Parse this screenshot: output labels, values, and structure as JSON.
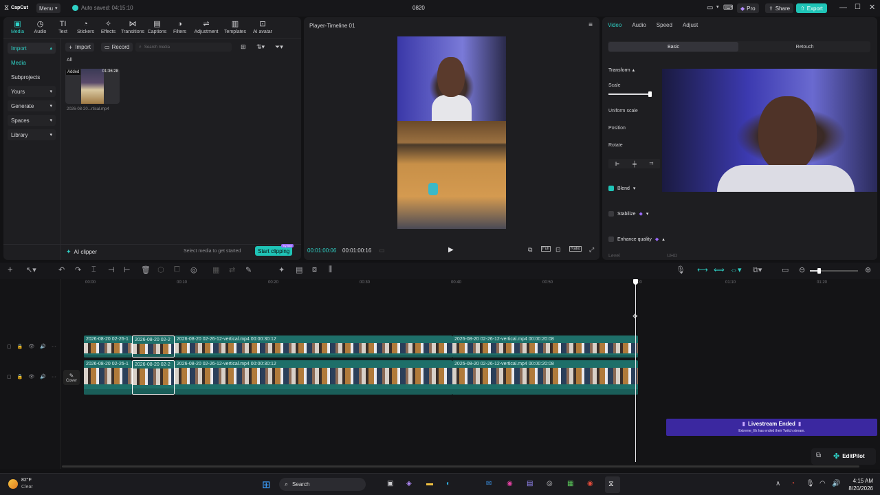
{
  "titlebar": {
    "logo": "CapCut",
    "menu": "Menu",
    "autosave": "Auto saved: 04:15:10",
    "project": "0820",
    "pro": "Pro",
    "share": "Share",
    "export": "Export"
  },
  "toolbar": {
    "items": [
      {
        "label": "Media",
        "icon": "media-icon"
      },
      {
        "label": "Audio",
        "icon": "audio-icon"
      },
      {
        "label": "Text",
        "icon": "text-icon"
      },
      {
        "label": "Stickers",
        "icon": "sticker-icon"
      },
      {
        "label": "Effects",
        "icon": "effects-icon"
      },
      {
        "label": "Transitions",
        "icon": "transitions-icon"
      },
      {
        "label": "Captions",
        "icon": "captions-icon"
      },
      {
        "label": "Filters",
        "icon": "filters-icon"
      },
      {
        "label": "Adjustment",
        "icon": "adjustment-icon"
      },
      {
        "label": "Templates",
        "icon": "templates-icon"
      },
      {
        "label": "AI avatar",
        "icon": "ai-avatar-icon"
      }
    ]
  },
  "sidebar": {
    "items": [
      "Import",
      "Media",
      "Subprojects",
      "Yours",
      "Generate",
      "Spaces",
      "Library"
    ]
  },
  "media": {
    "import_btn": "Import",
    "record_btn": "Record",
    "search_placeholder": "Search media",
    "filter_all": "All",
    "thumb_badge": "Added",
    "thumb_duration": "01:36:28",
    "thumb_name": "2026-08-20...rtical.mp4",
    "ai_clipper": "AI clipper",
    "hint": "Select media to get started",
    "start_clipping": "Start clipping",
    "try_free": "Try free"
  },
  "player": {
    "title": "Player-Timeline 01",
    "time_current": "00:01:00:06",
    "time_total": "00:01:00:16",
    "ratio": "Ratio",
    "full": "Full"
  },
  "inspector": {
    "tabs": [
      "Video",
      "Audio",
      "Speed",
      "Adjust"
    ],
    "subtabs": [
      "Basic",
      "Retouch"
    ],
    "transform": "Transform",
    "scale": "Scale",
    "scale_value": 0.95,
    "uniform_scale": "Uniform scale",
    "position": "Position",
    "rotate": "Rotate",
    "blend": "Blend",
    "stabilize": "Stabilize",
    "enhance": "Enhance quality",
    "level": "Level",
    "level_value": "UHD"
  },
  "timeline": {
    "ruler": [
      "00:00",
      "00:10",
      "00:20",
      "00:30",
      "00:40",
      "00:50",
      "1:00",
      "01:10",
      "01:20"
    ],
    "cover": "Cover",
    "track1": [
      {
        "label": "2026-08-20 02-26-1"
      },
      {
        "label": "2026-08-20 02-2"
      },
      {
        "label": "2026-08-20 02-26-12-vertical.mp4   00:00:30:12"
      },
      {
        "label": "2026-08-20 02-26-12-vertical.mp4   00:00:20:08"
      }
    ],
    "track2": [
      {
        "label": "2026-08-20 02-26-1"
      },
      {
        "label": "2026-08-20 02-2"
      },
      {
        "label": "2026-08-20 02-26-12-vertical.mp4   00:00:30:12"
      },
      {
        "label": "2026-08-20 02-26-12-vertical.mp4   00:00:20:08"
      }
    ]
  },
  "notification": {
    "title": "Livestream Ended",
    "body": "Extreme_Ek has ended their Twitch stream."
  },
  "editpilot": "EditPilot",
  "taskbar": {
    "temp": "82°F",
    "weather": "Clear",
    "search": "Search",
    "time": "4:15 AM",
    "date": "8/20/2026"
  }
}
